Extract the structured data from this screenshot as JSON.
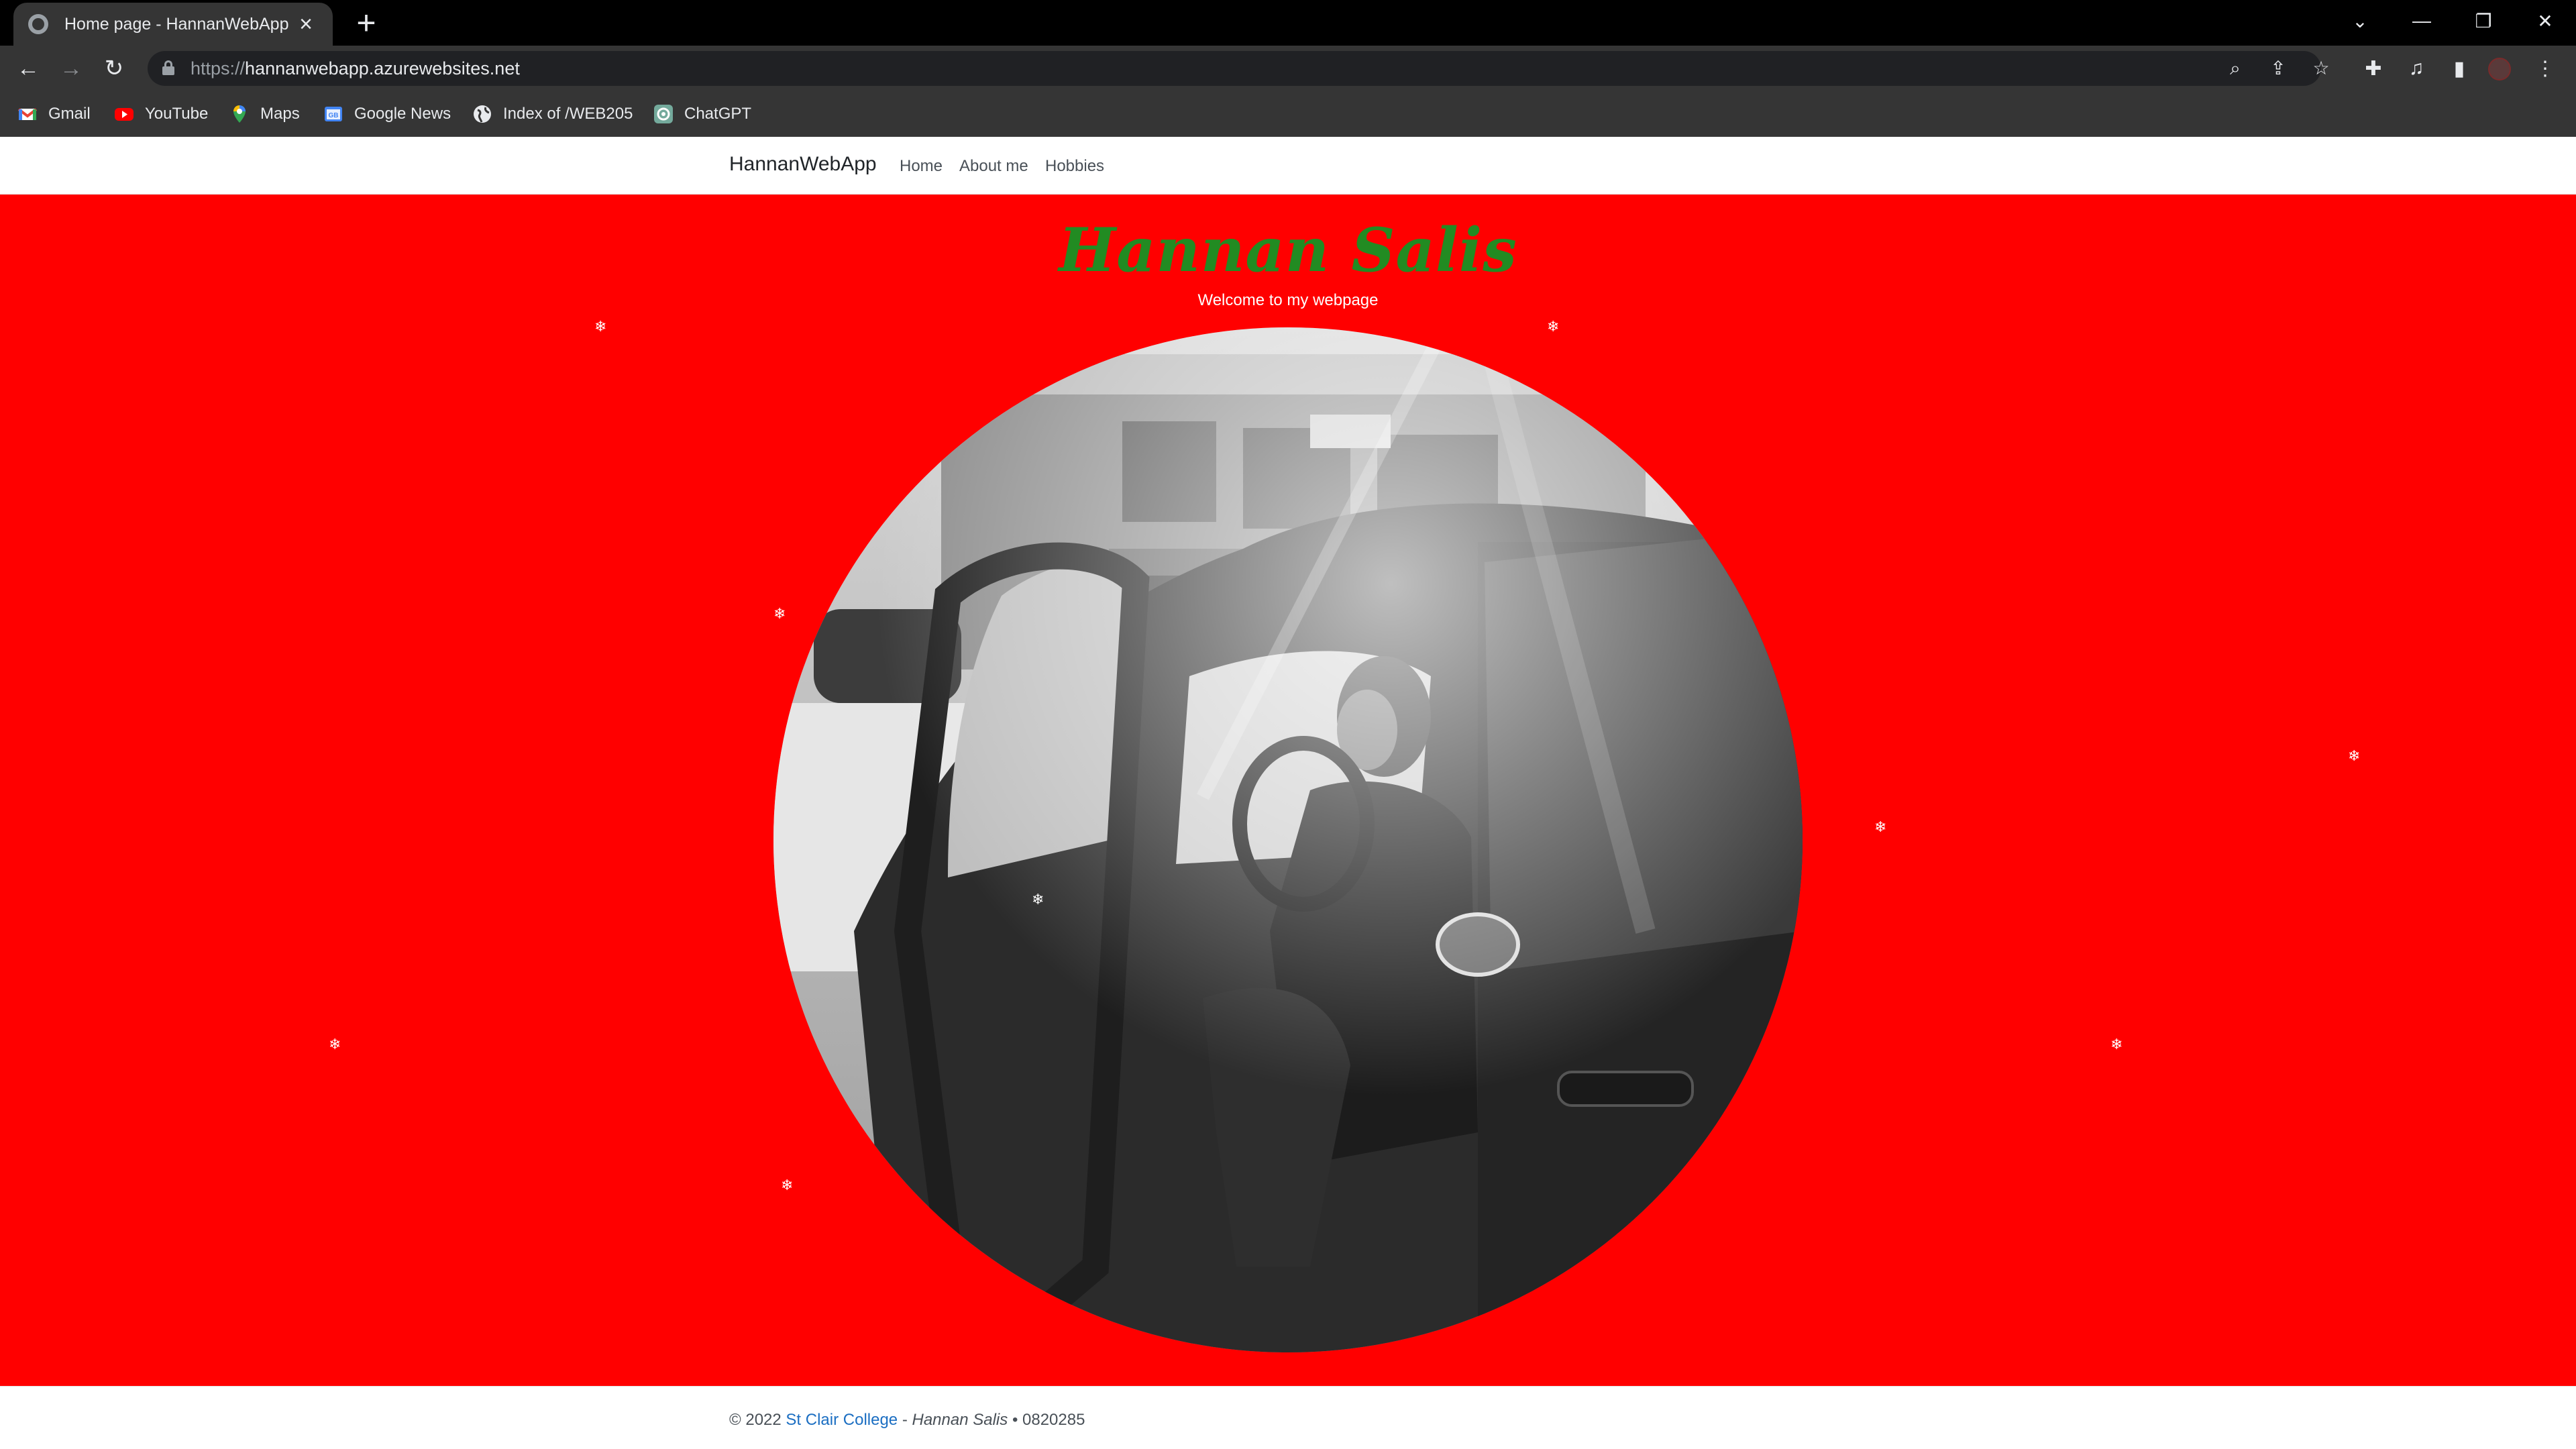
{
  "browser": {
    "tab_title": "Home page - HannanWebApp",
    "url_scheme": "https://",
    "url_host": "hannanwebapp.azurewebsites.net",
    "bookmarks": [
      {
        "label": "Gmail",
        "icon": "gmail-icon"
      },
      {
        "label": "YouTube",
        "icon": "youtube-icon"
      },
      {
        "label": "Maps",
        "icon": "maps-icon"
      },
      {
        "label": "Google News",
        "icon": "google-news-icon"
      },
      {
        "label": "Index of /WEB205",
        "icon": "globe-icon"
      },
      {
        "label": "ChatGPT",
        "icon": "chatgpt-icon"
      }
    ]
  },
  "site": {
    "brand": "HannanWebApp",
    "nav": [
      "Home",
      "About me",
      "Hobbies"
    ],
    "hero": {
      "title": "Hannan Salis",
      "subtitle": "Welcome to my webpage",
      "background_color": "#ff0000",
      "title_color": "#228b22"
    },
    "footer": {
      "copyright": "© 2022",
      "college": "St Clair College",
      "separator": "-",
      "name": "Hannan Salis",
      "id": "• 0820285"
    }
  }
}
